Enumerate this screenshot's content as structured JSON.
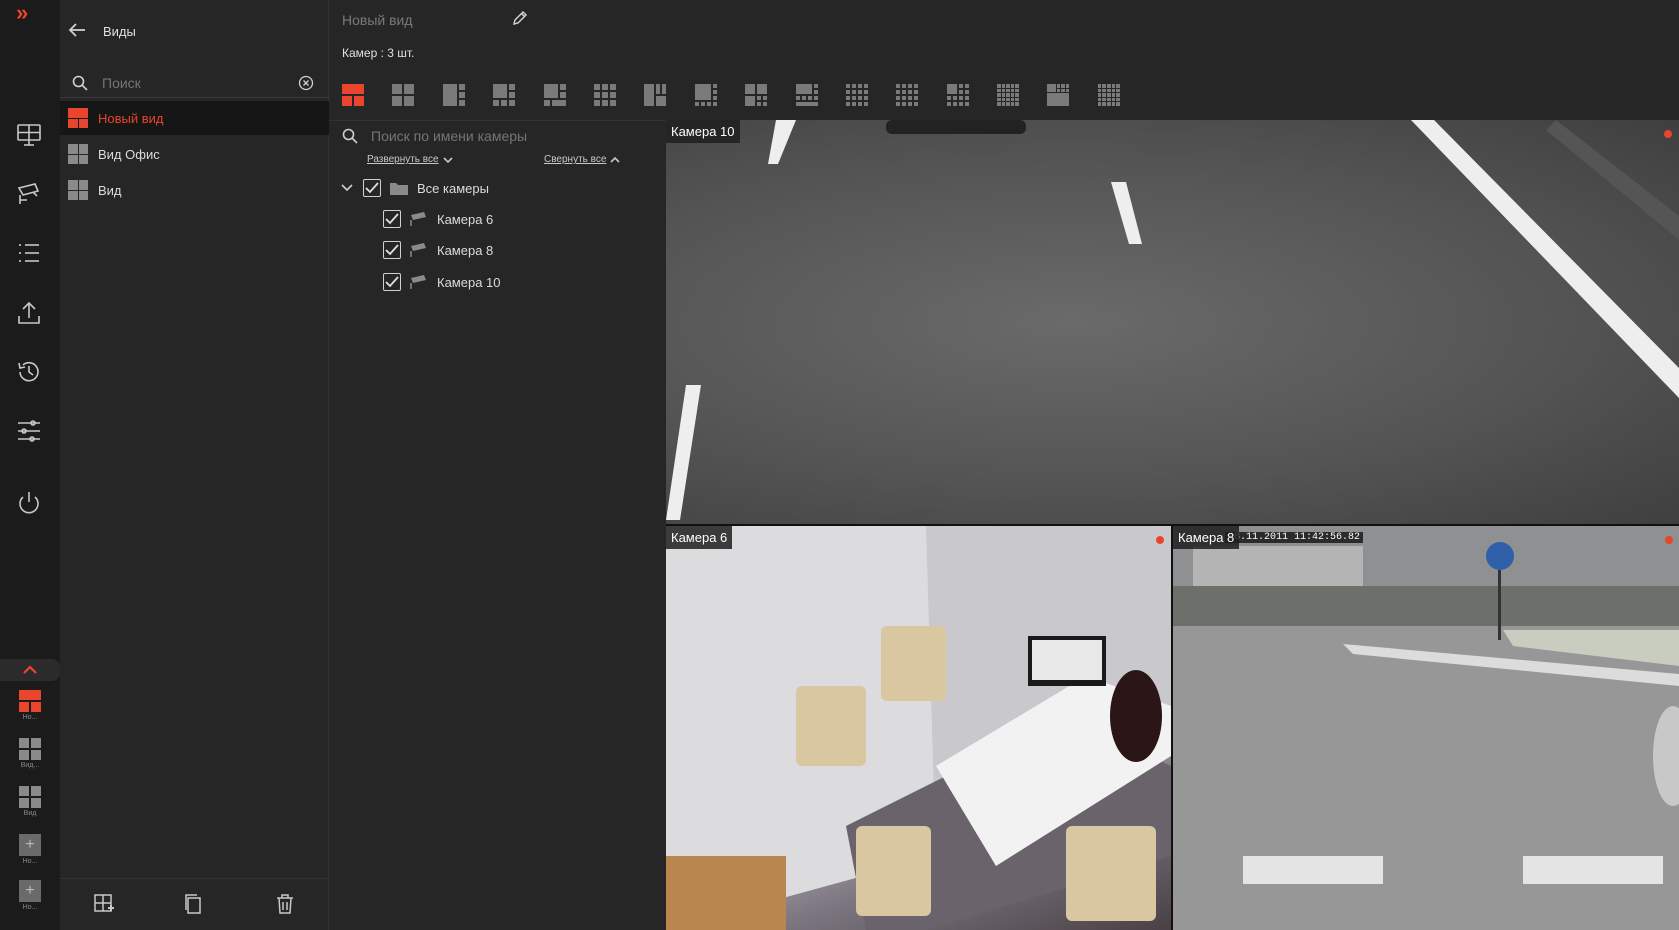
{
  "rail": {
    "expand_glyph": "»",
    "nav": [
      {
        "name": "monitor-icon"
      },
      {
        "name": "camera-icon"
      },
      {
        "name": "list-icon"
      },
      {
        "name": "upload-icon"
      },
      {
        "name": "history-icon"
      },
      {
        "name": "sliders-icon"
      },
      {
        "name": "power-icon"
      }
    ],
    "quick_views": [
      {
        "label": "Но..."
      },
      {
        "label": "Вид..."
      },
      {
        "label": "Вид"
      },
      {
        "label": "Но..."
      },
      {
        "label": "Но..."
      }
    ]
  },
  "views_panel": {
    "title": "Виды",
    "search_placeholder": "Поиск",
    "items": [
      {
        "label": "Новый вид",
        "active": true
      },
      {
        "label": "Вид Офис",
        "active": false
      },
      {
        "label": "Вид",
        "active": false
      }
    ]
  },
  "editor": {
    "view_name_placeholder": "Новый вид",
    "camera_count": "Камер : 3 шт.",
    "layout_count": 16
  },
  "tree": {
    "search_placeholder": "Поиск по имени камеры",
    "expand_all": "Развернуть все",
    "collapse_all": "Свернуть все",
    "root": "Все камеры",
    "cameras": [
      "Камера 6",
      "Камера 8",
      "Камера 10"
    ]
  },
  "tiles": {
    "top": {
      "label": "Камера 10"
    },
    "bottom_left": {
      "label": "Камера 6"
    },
    "bottom_right": {
      "label": "Камера 8",
      "timestamp": "08.11.2011 11:42:56.82"
    }
  },
  "colors": {
    "accent": "#e8452c",
    "panel": "#262626",
    "rail": "#1b1b1b"
  }
}
